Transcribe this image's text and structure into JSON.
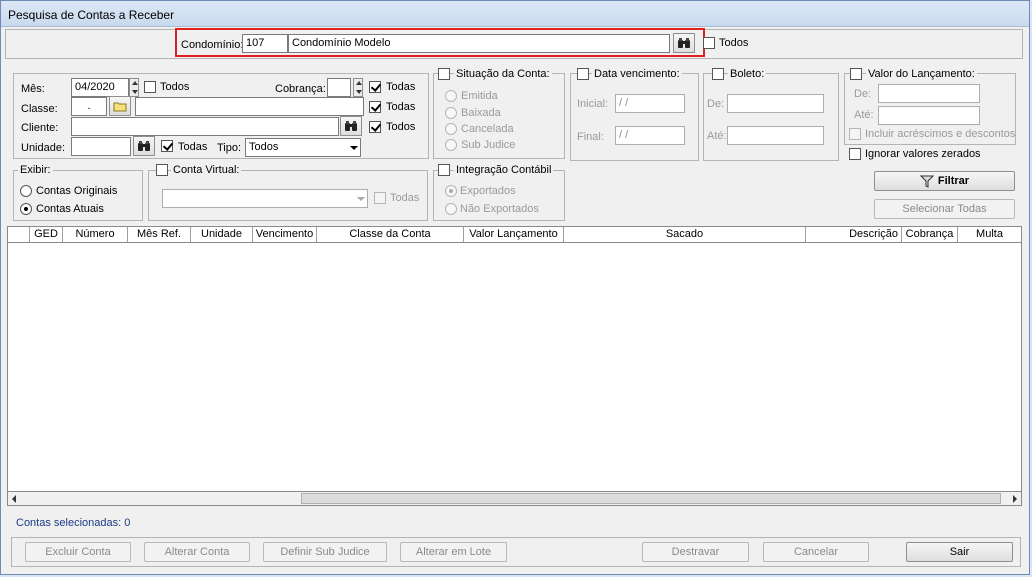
{
  "window": {
    "title": "Pesquisa de Contas a Receber"
  },
  "condominio": {
    "label": "Condomínio:",
    "code": "107",
    "name": "Condomínio Modelo",
    "todos_label": "Todos",
    "highlight_color": "#e02020"
  },
  "filters": {
    "mes_label": "Mês:",
    "mes_value": "04/2020",
    "mes_todos": "Todos",
    "cobranca_label": "Cobrança:",
    "cobranca_value": "",
    "cobranca_todas": "Todas",
    "classe_label": "Classe:",
    "classe_code": ".",
    "classe_todas": "Todas",
    "cliente_label": "Cliente:",
    "cliente_todos": "Todos",
    "unidade_label": "Unidade:",
    "unidade_todas": "Todas",
    "tipo_label": "Tipo:",
    "tipo_value": "Todos"
  },
  "situacao": {
    "title": "Situação da Conta:",
    "options": [
      "Emitida",
      "Baixada",
      "Cancelada",
      "Sub Judice"
    ]
  },
  "data_vencimento": {
    "title": "Data vencimento:",
    "inicial_label": "Inicial:",
    "inicial_value": " / /",
    "final_label": "Final:",
    "final_value": " / /"
  },
  "boleto": {
    "title": "Boleto:",
    "de_label": "De:",
    "ate_label": "Até:"
  },
  "valor": {
    "title": "Valor do Lançamento:",
    "de_label": "De:",
    "ate_label": "Até:",
    "incluir_label": "Incluir acréscimos e descontos",
    "ignorar_label": "Ignorar valores zerados"
  },
  "exibir": {
    "title": "Exibir:",
    "options": [
      "Contas Originais",
      "Contas Atuais"
    ],
    "selected": "Contas Atuais"
  },
  "conta_virtual": {
    "title": "Conta Virtual:",
    "todas_label": "Todas"
  },
  "integracao": {
    "title": "Integração Contábil",
    "options": [
      "Exportados",
      "Não Exportados"
    ],
    "selected": "Exportados"
  },
  "actions": {
    "filtrar": "Filtrar",
    "selecionar_todas": "Selecionar Todas"
  },
  "grid": {
    "columns": [
      "",
      "GED",
      "Número",
      "Mês Ref.",
      "Unidade",
      "Vencimento",
      "Classe da Conta",
      "Valor Lançamento",
      "Sacado",
      "Descrição",
      "Cobrança",
      "Multa"
    ]
  },
  "status": {
    "text": "Contas selecionadas: 0",
    "color": "#1a3a8a"
  },
  "footer": {
    "excluir": "Excluir Conta",
    "alterar": "Alterar Conta",
    "definir_sub": "Definir Sub Judice",
    "alterar_lote": "Alterar em Lote",
    "destravar": "Destravar",
    "cancelar": "Cancelar",
    "sair": "Sair"
  }
}
